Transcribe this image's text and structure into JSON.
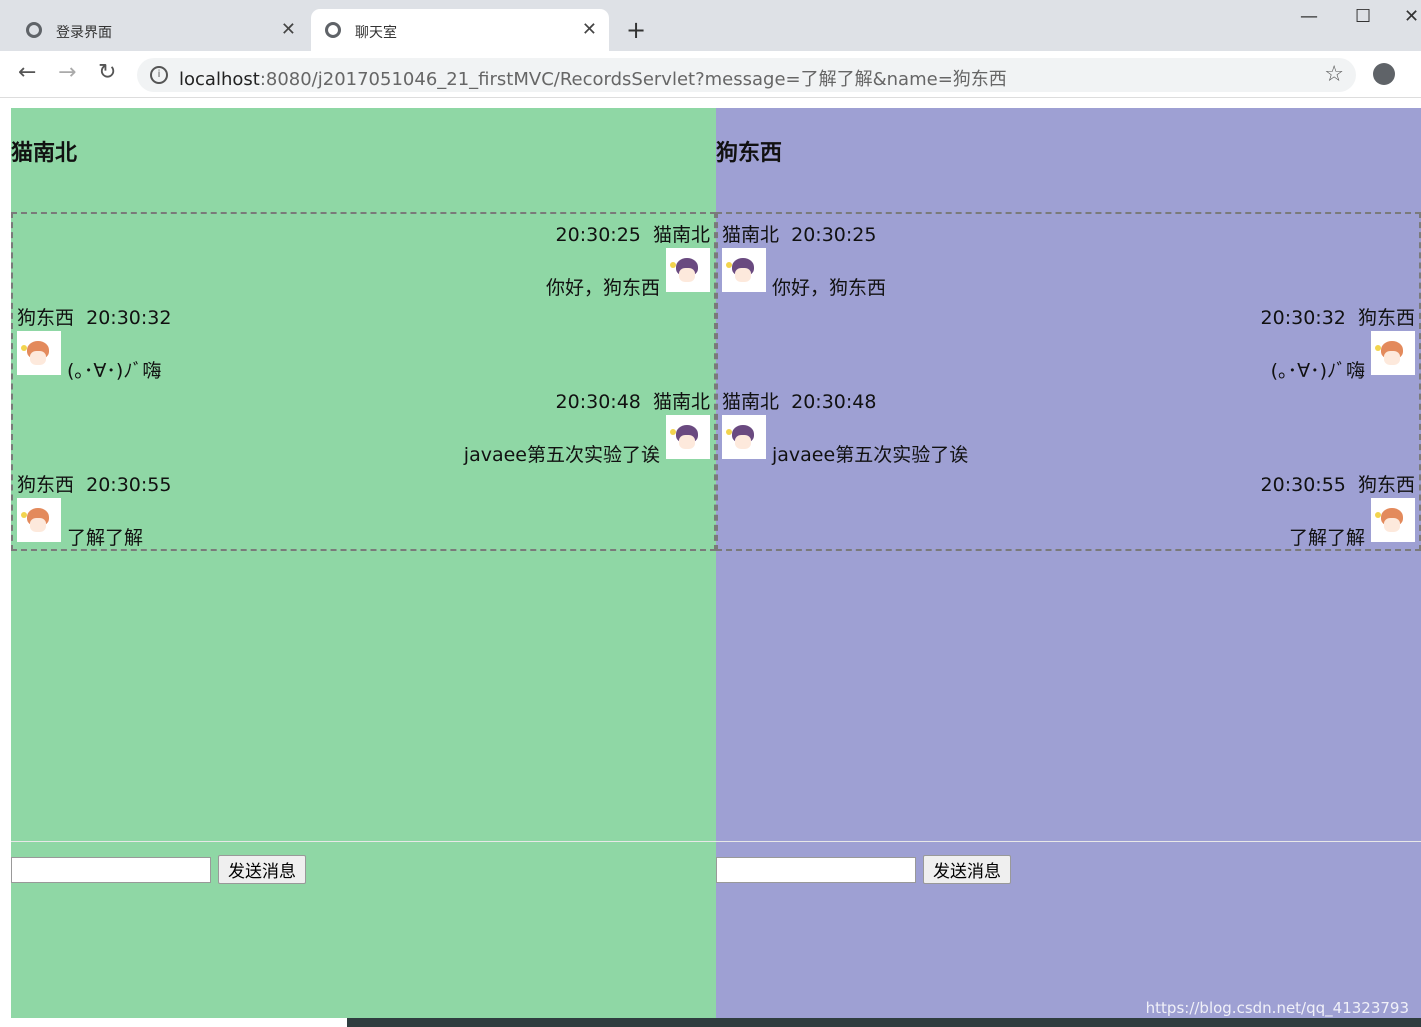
{
  "browser": {
    "tabs": [
      {
        "title": "登录界面",
        "active": false
      },
      {
        "title": "聊天室",
        "active": true
      }
    ],
    "new_tab": "+",
    "window_controls": {
      "minimize": "—",
      "maximize": "☐",
      "close": "✕"
    },
    "nav": {
      "back": "←",
      "forward": "→",
      "reload": "↻"
    },
    "url_host": "localhost",
    "url_rest": ":8080/j2017051046_21_firstMVC/RecordsServlet?message=了解了解&name=狗东西",
    "bookmark_icon": "star-icon",
    "account_icon": "account-icon"
  },
  "colors": {
    "left_panel": "#8fd7a5",
    "right_panel": "#9ea0d3"
  },
  "left": {
    "name": "猫南北",
    "send_label": "发送消息",
    "messages": [
      {
        "sender": "猫南北",
        "time": "20:30:25",
        "text": "你好，狗东西",
        "mine": true,
        "avatar": "cat-avatar"
      },
      {
        "sender": "狗东西",
        "time": "20:30:32",
        "text": "(｡･∀･)ﾉﾞ嗨",
        "mine": false,
        "avatar": "dog-avatar"
      },
      {
        "sender": "猫南北",
        "time": "20:30:48",
        "text": "javaee第五次实验了诶",
        "mine": true,
        "avatar": "cat-avatar"
      },
      {
        "sender": "狗东西",
        "time": "20:30:55",
        "text": "了解了解",
        "mine": false,
        "avatar": "dog-avatar"
      }
    ]
  },
  "right": {
    "name": "狗东西",
    "send_label": "发送消息",
    "messages": [
      {
        "sender": "猫南北",
        "time": "20:30:25",
        "text": "你好，狗东西",
        "mine": false,
        "avatar": "cat-avatar"
      },
      {
        "sender": "狗东西",
        "time": "20:30:32",
        "text": "(｡･∀･)ﾉﾞ嗨",
        "mine": true,
        "avatar": "dog-avatar"
      },
      {
        "sender": "猫南北",
        "time": "20:30:48",
        "text": "javaee第五次实验了诶",
        "mine": false,
        "avatar": "cat-avatar"
      },
      {
        "sender": "狗东西",
        "time": "20:30:55",
        "text": "了解了解",
        "mine": true,
        "avatar": "dog-avatar"
      }
    ]
  },
  "watermark": "https://blog.csdn.net/qq_41323793"
}
